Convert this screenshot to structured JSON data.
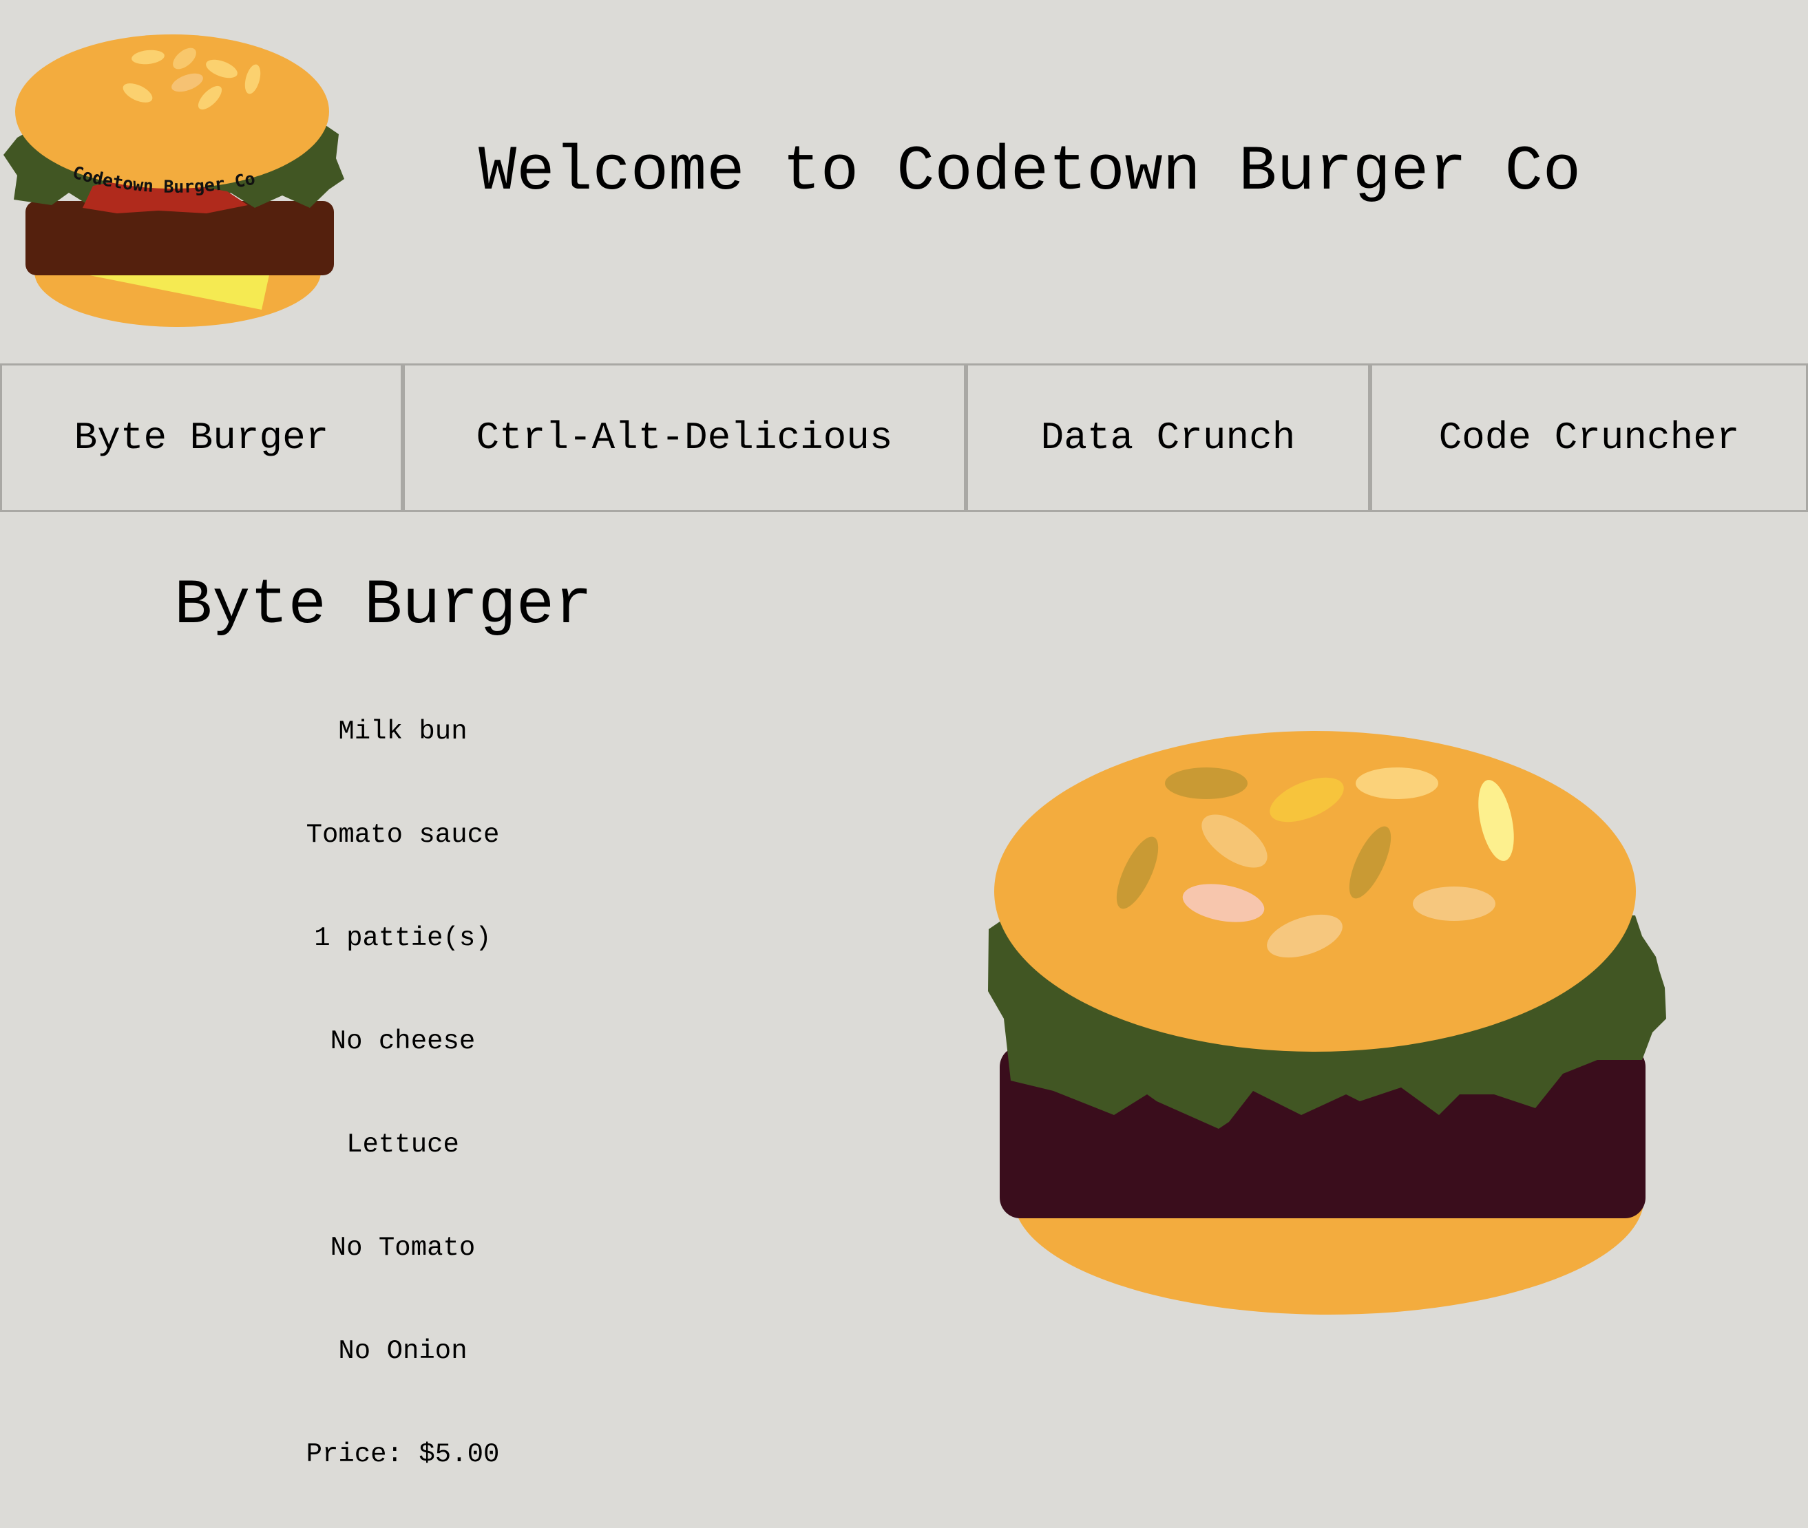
{
  "header": {
    "title": "Welcome to Codetown Burger Co",
    "logo_text": "Codetown Burger Co"
  },
  "nav": {
    "tabs": [
      {
        "label": "Byte Burger",
        "selected": true
      },
      {
        "label": "Ctrl-Alt-Delicious",
        "selected": false
      },
      {
        "label": "Data Crunch",
        "selected": false
      },
      {
        "label": "Code Cruncher",
        "selected": false
      }
    ]
  },
  "burger": {
    "name": "Byte Burger",
    "ingredients": [
      "Milk bun",
      "Tomato sauce",
      "1 pattie(s)",
      "No cheese",
      "Lettuce",
      "No Tomato",
      "No Onion",
      "Price: $5.00"
    ]
  },
  "colors": {
    "background": "#dcdbd7",
    "bun": "#f3ac3e",
    "lettuce": "#415623",
    "patty": "#3a0d1c",
    "logo_patty": "#54200d",
    "cheese": "#f5ea52",
    "sauce": "#b02a1c",
    "tab_border": "#a9a8a4"
  }
}
